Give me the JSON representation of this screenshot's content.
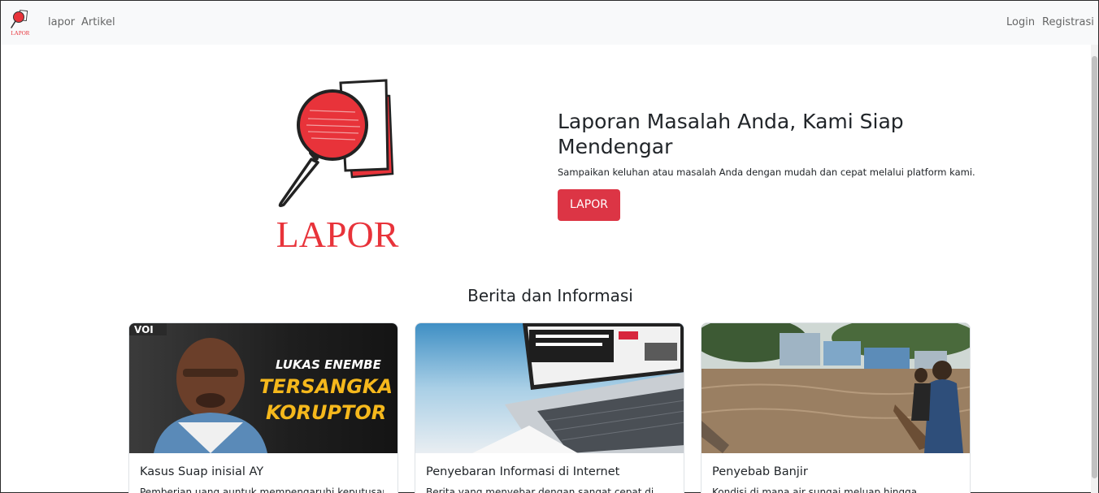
{
  "nav": {
    "brand_text": "LAPOR",
    "links": [
      "lapor",
      "Artikel"
    ],
    "login": "Login",
    "register": "Registrasi"
  },
  "hero": {
    "logo_text": "LAPOR",
    "title": "Laporan Masalah Anda, Kami Siap Mendengar",
    "subtitle": "Sampaikan keluhan atau masalah Anda dengan mudah dan cepat melalui platform kami.",
    "button": "LAPOR"
  },
  "section": {
    "title": "Berita dan Informasi"
  },
  "cards": [
    {
      "title": "Kasus Suap inisial AY",
      "text": "Pemberian uang auntuk mempengaruhi keputusan",
      "image_overlay": [
        "LUKAS ENEMBE",
        "TERSANGKA",
        "KORUPTOR"
      ],
      "image_badge": "VOI"
    },
    {
      "title": "Penyebaran Informasi di Internet",
      "text": "Berita yang menyebar dengan sangat cepat di"
    },
    {
      "title": "Penyebab Banjir",
      "text": "Kondisi di mana air sungai meluap hingga"
    }
  ],
  "colors": {
    "brand_red": "#dc3545",
    "logo_red": "#e8333a",
    "navbar_bg": "#f8f9fa"
  }
}
